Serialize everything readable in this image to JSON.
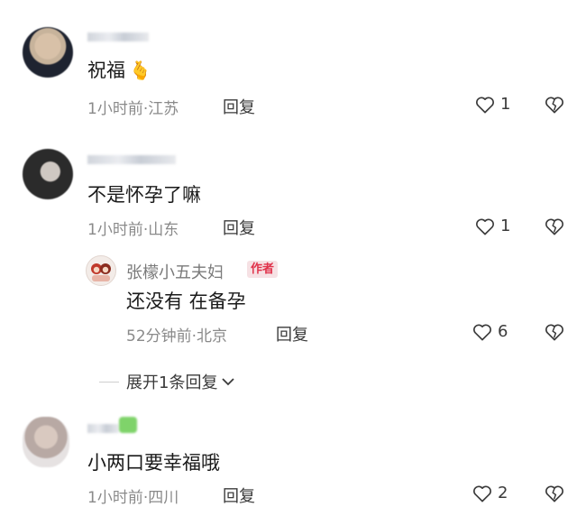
{
  "comments": [
    {
      "text": "祝福",
      "emoji": "🫰",
      "time": "1小时前",
      "location": "江苏",
      "reply_label": "回复",
      "likes": "1"
    },
    {
      "text": "不是怀孕了嘛",
      "time": "1小时前",
      "location": "山东",
      "reply_label": "回复",
      "likes": "1",
      "replies": [
        {
          "name": "张檬小五夫妇",
          "badge": "作者",
          "text": "还没有 在备孕",
          "time": "52分钟前",
          "location": "北京",
          "reply_label": "回复",
          "likes": "6"
        }
      ],
      "expand_label": "展开1条回复"
    },
    {
      "text": "小两口要幸福哦",
      "time": "1小时前",
      "location": "四川",
      "reply_label": "回复",
      "likes": "2"
    }
  ],
  "meta_separator": "·",
  "icons": {
    "like": "heart-outline-icon",
    "dislike": "broken-heart-icon",
    "expand": "chevron-down-icon"
  }
}
